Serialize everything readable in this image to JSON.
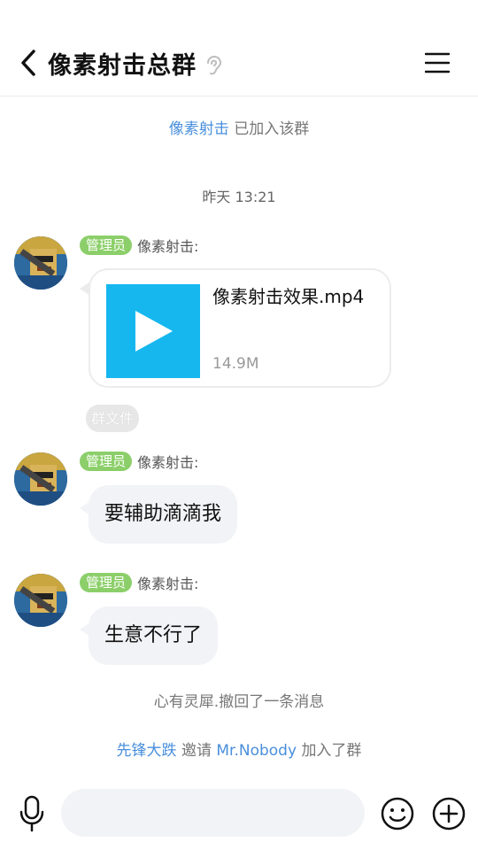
{
  "header": {
    "title": "像素射击总群"
  },
  "system": {
    "join_user": "像素射击",
    "join_text": "已加入该群",
    "timestamp": "昨天 13:21",
    "recall_text": "心有灵犀.撤回了一条消息",
    "invite_from": "先锋大跌",
    "invite_text1": "邀请",
    "invite_to": "Mr.Nobody",
    "invite_text2": "加入了群"
  },
  "messages": [
    {
      "role": "管理员",
      "sender": "像素射击:",
      "type": "file",
      "file_name": "像素射击效果.mp4",
      "file_size": "14.9M",
      "tag": "群文件"
    },
    {
      "role": "管理员",
      "sender": "像素射击:",
      "type": "text",
      "text": "要辅助滴滴我"
    },
    {
      "role": "管理员",
      "sender": "像素射击:",
      "type": "text",
      "text": "生意不行了"
    }
  ],
  "colors": {
    "link_blue": "#4a8fdc",
    "role_green": "#8ccf6a",
    "video_thumb": "#16b7ef",
    "bubble_bg": "#f2f3f6"
  },
  "icons": {
    "back": "chevron-left-icon",
    "ear": "ear-icon",
    "menu": "hamburger-menu-icon",
    "mic": "microphone-icon",
    "emoji": "emoji-icon",
    "plus": "plus-icon",
    "play": "play-icon"
  }
}
